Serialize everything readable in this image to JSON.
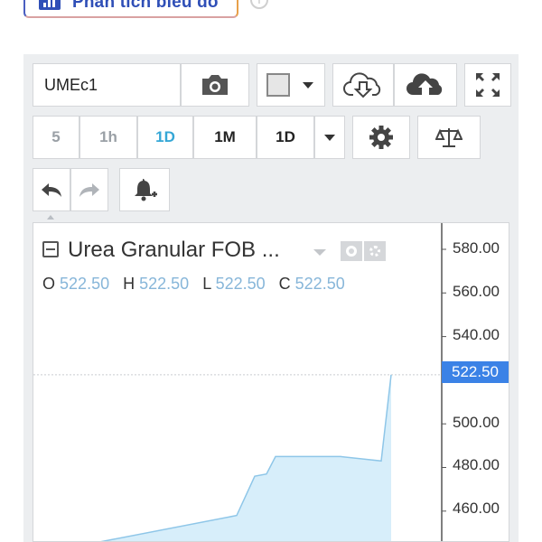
{
  "top_button": {
    "label": "Phân tích biểu đồ"
  },
  "info_icon": "i",
  "toolbar": {
    "symbol": "UMEc1",
    "intervals": [
      "5",
      "1h",
      "1D",
      "1M",
      "1D"
    ],
    "active_interval": "1D"
  },
  "legend": {
    "title": "Urea Granular FOB ...",
    "ohlc": [
      {
        "key": "O",
        "value": "522.50"
      },
      {
        "key": "H",
        "value": "522.50"
      },
      {
        "key": "L",
        "value": "522.50"
      },
      {
        "key": "C",
        "value": "522.50"
      }
    ]
  },
  "price_axis": {
    "labels": [
      "580.00",
      "560.00",
      "540.00",
      "500.00",
      "480.00",
      "460.00"
    ],
    "current_price": "522.50"
  },
  "colors": {
    "accent": "#35a7d6",
    "price_tag": "#3b82e6",
    "area_fill": "#d7eefa",
    "area_line": "#8ec6e8"
  },
  "chart_data": {
    "type": "area",
    "title": "Urea Granular FOB ...",
    "ylim": [
      450,
      588
    ],
    "series": [
      {
        "points": [
          {
            "t": 0,
            "v": 440
          },
          {
            "t": 1,
            "v": 458
          },
          {
            "t": 2,
            "v": 476
          },
          {
            "t": 3,
            "v": 477
          },
          {
            "t": 4,
            "v": 485
          },
          {
            "t": 5,
            "v": 485
          },
          {
            "t": 6,
            "v": 485
          },
          {
            "t": 7,
            "v": 483
          },
          {
            "t": 8,
            "v": 522.5
          }
        ]
      }
    ]
  }
}
